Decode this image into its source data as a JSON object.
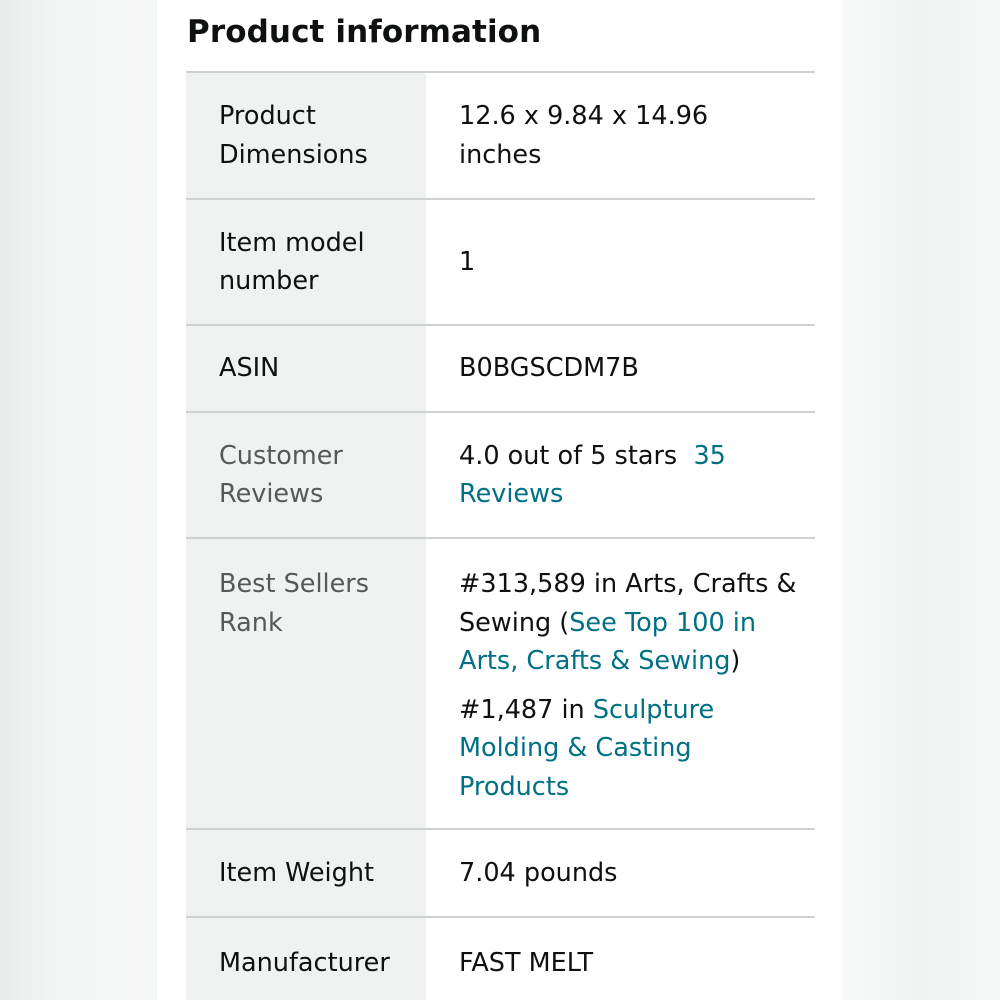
{
  "section": {
    "title": "Product information"
  },
  "rows": {
    "dimensions": {
      "label": "Product Dimensions",
      "value": "12.6 x 9.84 x 14.96 inches"
    },
    "model": {
      "label": "Item model number",
      "value": "1"
    },
    "asin": {
      "label": "ASIN",
      "value": "B0BGSCDM7B"
    },
    "reviews": {
      "label": "Customer Reviews",
      "stars_text": "4.0 out of 5 stars",
      "reviews_link": "35 Reviews"
    },
    "rank": {
      "label": "Best Sellers Rank",
      "rank1_prefix": "#313,589 in Arts, Crafts & Sewing (",
      "rank1_link": "See Top 100 in Arts, Crafts & Sewing",
      "rank1_suffix": ")",
      "rank2_prefix": "#1,487 in ",
      "rank2_link": "Sculpture Molding & Casting Products"
    },
    "weight": {
      "label": "Item Weight",
      "value": "7.04 pounds"
    },
    "manufacturer": {
      "label": "Manufacturer",
      "value": "FAST MELT"
    }
  },
  "colors": {
    "link": "#007185",
    "text": "#0f1111",
    "muted": "#565959",
    "label_bg": "#f0f2f2",
    "divider": "#cfd2d2"
  }
}
